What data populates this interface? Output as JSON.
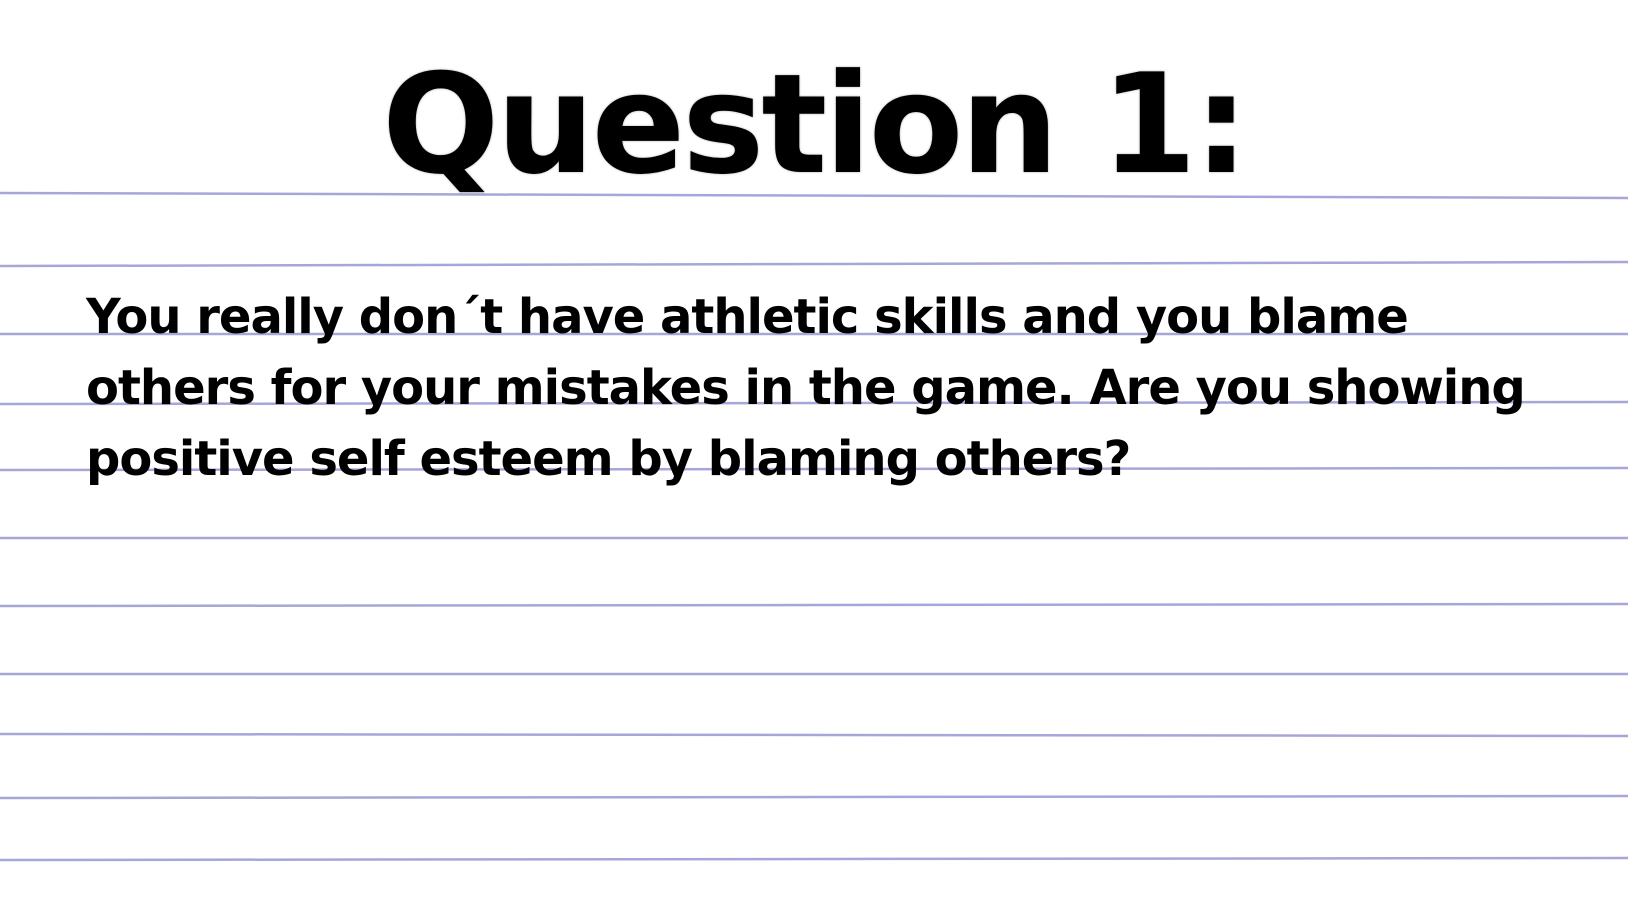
{
  "slide": {
    "title": "Question 1:",
    "question": "You really don´t have athletic skills and you blame others for your mistakes in the game. Are you showing positive self esteem by blaming others?"
  },
  "colors": {
    "background": "#ffffff",
    "ruled_line": "#a7a6d8",
    "text": "#000000"
  }
}
